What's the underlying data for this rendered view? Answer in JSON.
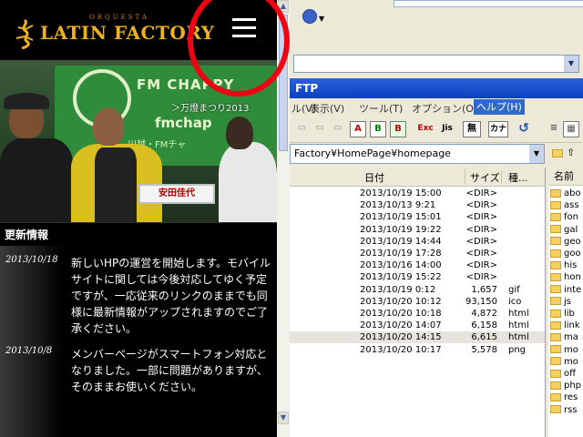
{
  "site": {
    "logo_small": "ORQUESTA",
    "logo_text": "LATIN FACTORY",
    "photo": {
      "banner_text": "FM CHAPPY",
      "banner_url": "fmchap",
      "banner_sub": "川越・FMチャ",
      "caption": "＞万燈まつり2013",
      "nameplate": "安田佳代"
    },
    "updates_heading": "更新情報",
    "news": [
      {
        "date": "2013/10/18",
        "text": "新しいHPの運営を開始します。モバイルサイトに関しては今後対応してゆく予定ですが、一応従来のリンクのままでも同様に最新情報がアップされますのでご了承ください。"
      },
      {
        "date": "2013/10/8",
        "text": "メンバーページがスマートフォン対応となりました。一部に問題がありますが、そのままお使いください。"
      }
    ]
  },
  "ftp": {
    "title": "FTP",
    "menu": [
      "ル(V)",
      "表示(V)",
      "ツール(T)",
      "オプション(O)",
      "ヘルプ(H)"
    ],
    "toolbar_icons": [
      {
        "name": "folder-open-icon",
        "label": ""
      },
      {
        "name": "ascii-mode-icon",
        "label": "A"
      },
      {
        "name": "binary-mode-icon",
        "label": "B"
      },
      {
        "name": "auto-mode-icon",
        "label": "B"
      },
      {
        "name": "ex-icon",
        "label": "Exc"
      },
      {
        "name": "jis-icon",
        "label": "Jis"
      },
      {
        "name": "none-icon",
        "label": "無"
      },
      {
        "name": "kana-icon",
        "label": "カナ"
      },
      {
        "name": "refresh-icon",
        "label": "↺"
      }
    ],
    "path": "Factory¥HomePage¥homepage",
    "columns": {
      "date": "日付",
      "size": "サイズ",
      "type": "種..."
    },
    "rows": [
      {
        "date": "2013/10/19 15:00",
        "size": "<DIR>",
        "type": ""
      },
      {
        "date": "2013/10/13   9:21",
        "size": "<DIR>",
        "type": ""
      },
      {
        "date": "2013/10/19 15:01",
        "size": "<DIR>",
        "type": ""
      },
      {
        "date": "2013/10/19 19:22",
        "size": "<DIR>",
        "type": ""
      },
      {
        "date": "2013/10/19 14:44",
        "size": "<DIR>",
        "type": ""
      },
      {
        "date": "2013/10/19 17:28",
        "size": "<DIR>",
        "type": ""
      },
      {
        "date": "2013/10/16 14:00",
        "size": "<DIR>",
        "type": ""
      },
      {
        "date": "2013/10/19 15:22",
        "size": "<DIR>",
        "type": ""
      },
      {
        "date": "2013/10/19   0:12",
        "size": "1,657",
        "type": "gif"
      },
      {
        "date": "2013/10/20 10:12",
        "size": "93,150",
        "type": "ico"
      },
      {
        "date": "2013/10/20 10:18",
        "size": "4,872",
        "type": "html"
      },
      {
        "date": "2013/10/20 14:07",
        "size": "6,158",
        "type": "html"
      },
      {
        "date": "2013/10/20 14:15",
        "size": "6,615",
        "type": "html"
      },
      {
        "date": "2013/10/20 10:17",
        "size": "5,578",
        "type": "png"
      }
    ],
    "tree_header": "名前",
    "tree": [
      "abo",
      "ass",
      "fon",
      "gal",
      "geo",
      "goo",
      "his",
      "hon",
      "inte",
      "js",
      "lib",
      "link",
      "ma",
      "mo",
      "mo",
      "off",
      "php",
      "res",
      "rss"
    ]
  },
  "colors": {
    "accent_red": "#f00010",
    "title_blue": "#0a40c0",
    "logo_gold": "#f0b020"
  }
}
